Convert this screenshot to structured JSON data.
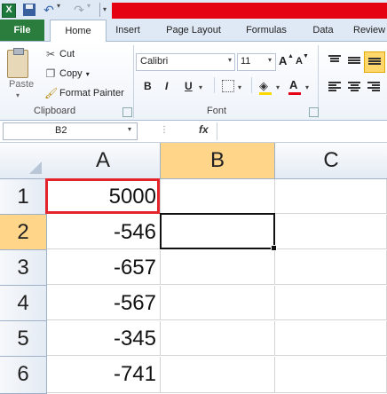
{
  "qat": {
    "undo_drop": "▾",
    "redo_drop": "▾",
    "customize": "▾"
  },
  "tabs": [
    "File",
    "Home",
    "Insert",
    "Page Layout",
    "Formulas",
    "Data",
    "Review"
  ],
  "active_tab": "Home",
  "clipboard": {
    "paste": "Paste",
    "cut": "Cut",
    "copy": "Copy",
    "copy_drop": "▾",
    "format_painter": "Format Painter",
    "group_label": "Clipboard"
  },
  "font": {
    "name": "Calibri",
    "size": "11",
    "bold": "B",
    "italic": "I",
    "underline": "U",
    "color_letter": "A",
    "grow": "A",
    "shrink": "A",
    "group_label": "Font",
    "fill_color": "#ffd800",
    "font_color": "#e50012"
  },
  "formula_bar": {
    "name_box": "B2",
    "fx": "fx",
    "formula": ""
  },
  "columns": [
    "A",
    "B",
    "C"
  ],
  "rows": [
    "1",
    "2",
    "3",
    "4",
    "5",
    "6"
  ],
  "cells": {
    "A": [
      "5000",
      "-546",
      "-657",
      "-567",
      "-345",
      "-741"
    ]
  },
  "active_cell": "B2",
  "highlight_cell": "A1",
  "colors": {
    "highlight": "#e3242b",
    "title_bar": "#e50012",
    "file_tab": "#2a7d3c"
  }
}
